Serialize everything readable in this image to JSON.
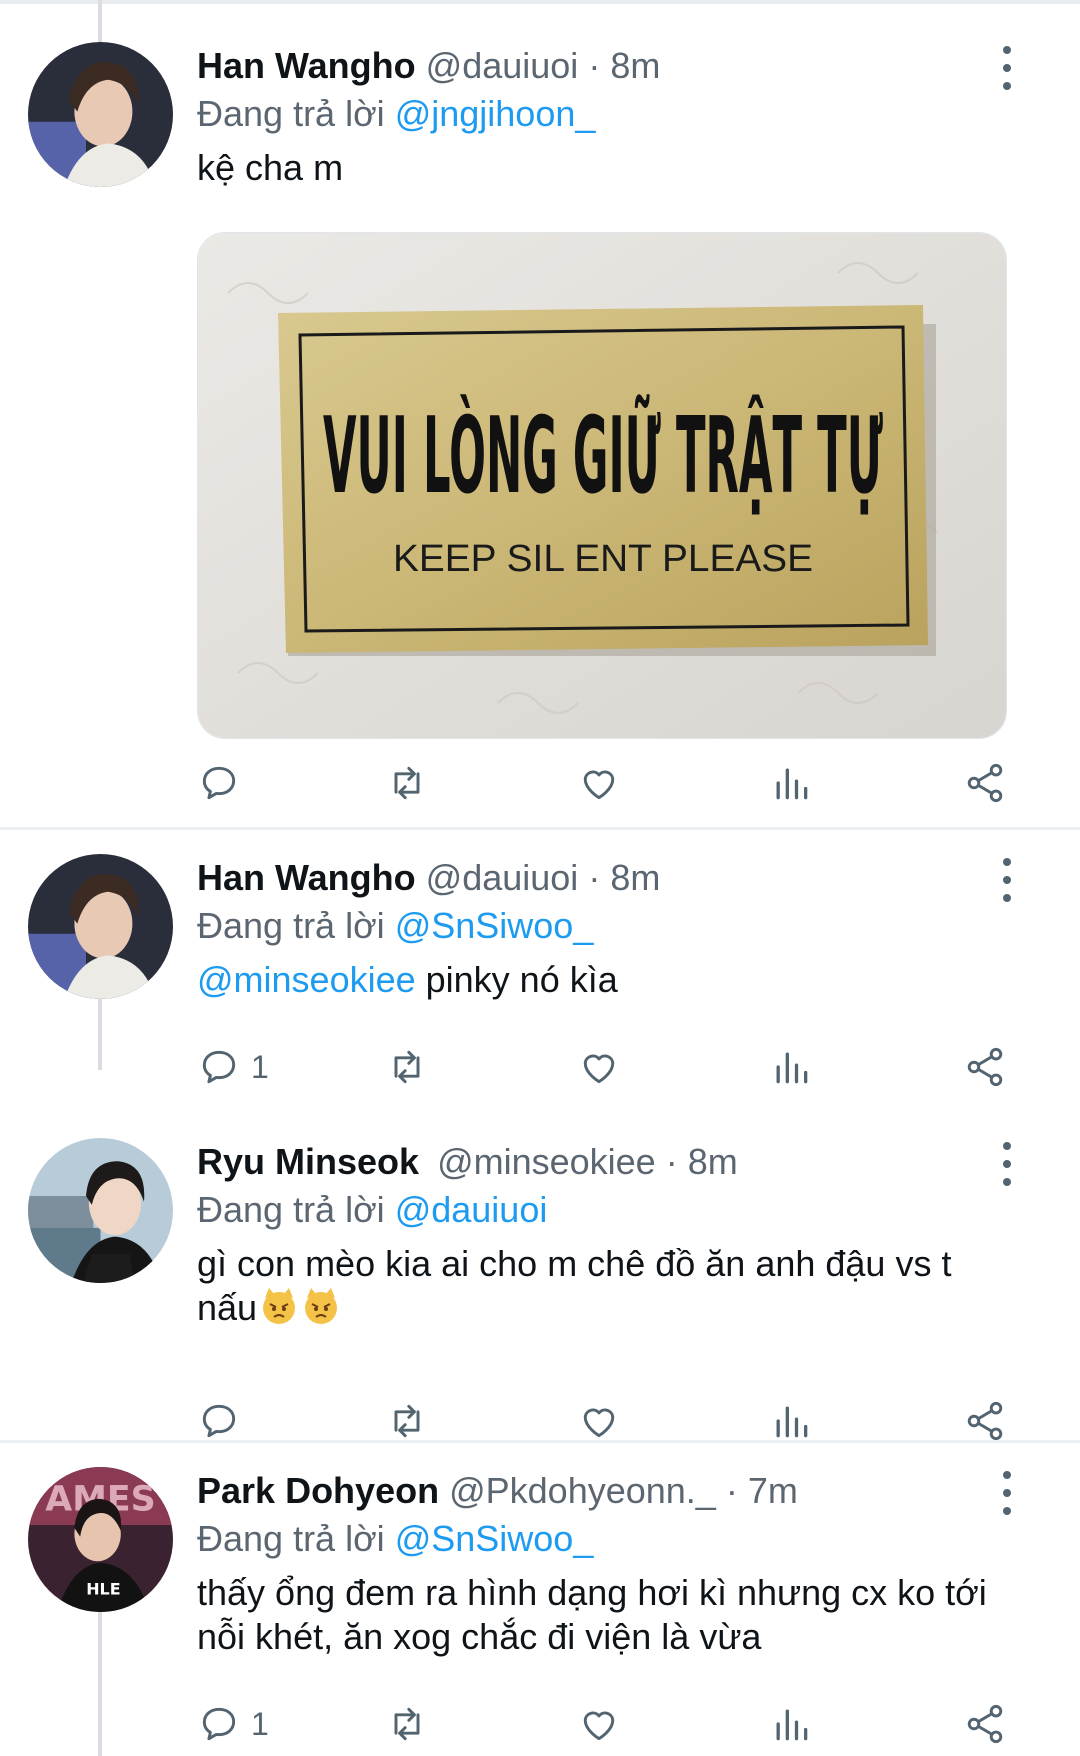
{
  "tweets": [
    {
      "name": "Han Wangho",
      "handle": "@dauiuoi",
      "time": "· 8m",
      "reply_prefix": "Đang trả lời ",
      "reply_to": "@jngjihoon_",
      "text": "kệ cha m",
      "media": {
        "sign_main": "VUI LÒNG GIỮ TRẬT TỰ",
        "sign_sub": "KEEP SIL ENT PLEASE"
      },
      "reply_count": ""
    },
    {
      "name": "Han Wangho",
      "handle": "@dauiuoi",
      "time": "· 8m",
      "reply_prefix": "Đang trả lời ",
      "reply_to": "@SnSiwoo_",
      "text_mention": "@minseokiee",
      "text": " pinky nó kìa",
      "reply_count": "1"
    },
    {
      "name": "Ryu Minseok",
      "handle": "@minseokiee",
      "time": "· 8m",
      "reply_prefix": "Đang trả lời ",
      "reply_to": "@dauiuoi",
      "text": "gì con mèo kia ai cho m chê đồ ăn anh đậu vs t nấu",
      "emoji": "pouting-cat-emoji x2",
      "reply_count": ""
    },
    {
      "name": "Park Dohyeon",
      "handle": "@Pkdohyeonn._",
      "time": "· 7m",
      "reply_prefix": "Đang trả lời ",
      "reply_to": "@SnSiwoo_",
      "text": "thấy ổng đem ra hình dạng hơi kì nhưng cx ko tới nỗi khét, ăn xog chắc đi viện là vừa",
      "reply_count": "1"
    }
  ],
  "icons": [
    "reply-icon",
    "retweet-icon",
    "like-icon",
    "analytics-icon",
    "share-icon",
    "more-icon"
  ],
  "colors": {
    "link": "#1d9bf0",
    "secondary": "#5b6670",
    "icon": "#536471",
    "text": "#0f1419"
  }
}
